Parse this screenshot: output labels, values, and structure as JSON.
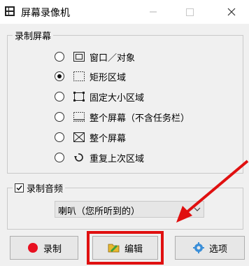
{
  "window": {
    "title": "屏幕录像机"
  },
  "capture": {
    "group_label": "录制屏幕",
    "modes": [
      {
        "label": "窗口／对象",
        "icon": "window-icon",
        "checked": false
      },
      {
        "label": "矩形区域",
        "icon": "dotted-rect-icon",
        "checked": true
      },
      {
        "label": "固定大小区域",
        "icon": "fixed-size-icon",
        "checked": false
      },
      {
        "label": "整个屏幕（不含任务栏）",
        "icon": "screen-no-taskbar-icon",
        "checked": false
      },
      {
        "label": "整个屏幕",
        "icon": "fullscreen-icon",
        "checked": false
      },
      {
        "label": "重复上次区域",
        "icon": "repeat-icon",
        "checked": false
      }
    ]
  },
  "audio": {
    "checkbox_label": "录制音频",
    "checked": true,
    "device": "喇叭（您所听到的）"
  },
  "buttons": {
    "record": "录制",
    "edit": "编辑",
    "options": "选项"
  },
  "colors": {
    "highlight": "#e01010",
    "record_dot": "#e81020"
  }
}
